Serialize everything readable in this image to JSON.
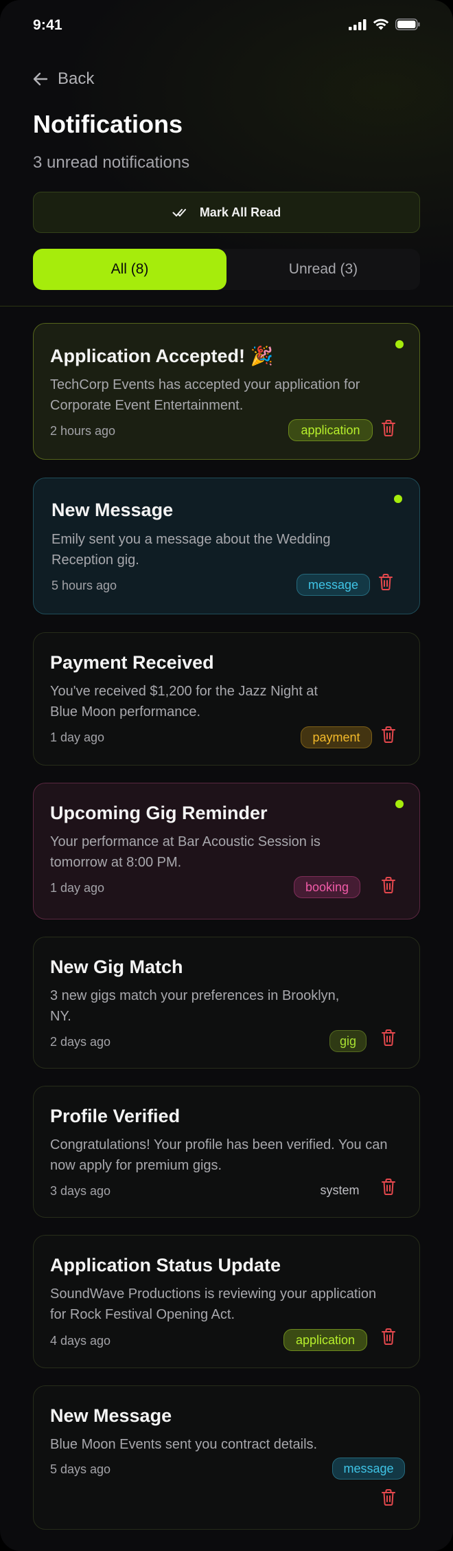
{
  "status_bar": {
    "time": "9:41"
  },
  "nav": {
    "back_label": "Back"
  },
  "header": {
    "title": "Notifications",
    "subtitle": "3 unread notifications",
    "mark_all_label": "Mark All Read"
  },
  "tabs": [
    {
      "label": "All (8)",
      "active": true
    },
    {
      "label": "Unread (3)",
      "active": false
    }
  ],
  "colors": {
    "accent": "#a6ec0c",
    "delete": "#e5484d",
    "background": "#0b0b0d"
  },
  "notifications": [
    {
      "title": "Application Accepted! 🎉",
      "text": "TechCorp Events has accepted your application for Corporate Event Entertainment.",
      "time": "2 hours ago",
      "tag": "application",
      "unread": true
    },
    {
      "title": "New Message",
      "text": "Emily sent you a message about the Wedding Reception gig.",
      "time": "5 hours ago",
      "tag": "message",
      "unread": true
    },
    {
      "title": "Payment Received",
      "text": "You've received $1,200 for the Jazz Night at Blue Moon performance.",
      "time": "1 day ago",
      "tag": "payment",
      "unread": false
    },
    {
      "title": "Upcoming Gig Reminder",
      "text": "Your performance at Bar Acoustic Session is tomorrow at 8:00 PM.",
      "time": "1 day ago",
      "tag": "booking",
      "unread": true
    },
    {
      "title": "New Gig Match",
      "text": "3 new gigs match your preferences in Brooklyn, NY.",
      "time": "2 days ago",
      "tag": "gig",
      "unread": false
    },
    {
      "title": "Profile Verified",
      "text": "Congratulations! Your profile has been verified. You can now apply for premium gigs.",
      "time": "3 days ago",
      "tag": "system",
      "unread": false
    },
    {
      "title": "Application Status Update",
      "text": "SoundWave Productions is reviewing your application for Rock Festival Opening Act.",
      "time": "4 days ago",
      "tag": "application",
      "unread": false
    },
    {
      "title": "New Message",
      "text": "Blue Moon Events sent you contract details.",
      "time": "5 days ago",
      "tag": "message",
      "unread": false
    }
  ]
}
